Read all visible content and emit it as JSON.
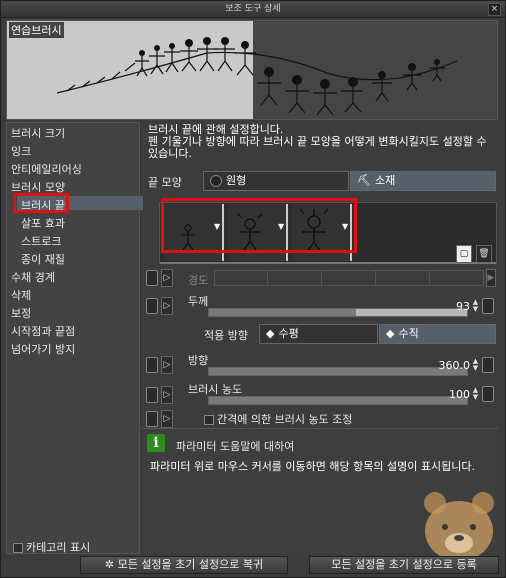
{
  "window": {
    "title": "보조 도구 상세",
    "close": "×"
  },
  "preview": {
    "label": "연습브러시"
  },
  "sidebar": {
    "items": [
      "브러시 크기",
      "잉크",
      "안티에일리어싱",
      "브러시 모양",
      "브러시 끝",
      "살포 효과",
      "스트로크",
      "종이 재질",
      "수채 경계",
      "삭제",
      "보정",
      "시작점과 끝점",
      "넘어가기 방지"
    ],
    "category_label": "카테고리 표시"
  },
  "main": {
    "description": "브러시 끝에 관해 설정합니다.\n펜 기울기나 방향에 따라 브러시 끝 모양을 어떻게 변화시킬지도 설정할 수 있습니다.",
    "tip_shape_label": "끝 모양",
    "tip_shape_circle": "원형",
    "tip_shape_material": "소재",
    "hardness_label": "경도",
    "thickness_label": "두께",
    "thickness_value": "93",
    "apply_direction_label": "적용 방향",
    "horizontal": "수평",
    "vertical": "수직",
    "direction_label": "방향",
    "direction_value": "360.0",
    "density_label": "브러시 농도",
    "density_value": "100",
    "interval_density_label": "간격에 의한 브러시 농도 조정"
  },
  "help": {
    "title": "파라미터 도움말에 대하여",
    "body": "파라미터 위로 마우스 커서를 이동하면 해당 항목의 설명이 표시됩니다."
  },
  "buttons": {
    "reset": "모든 설정을 초기 설정으로 복귀",
    "register": "모든 설정을 초기 설정으로 등록"
  },
  "colors": {
    "highlight_red": "#e01010",
    "selected": "#56606d"
  }
}
